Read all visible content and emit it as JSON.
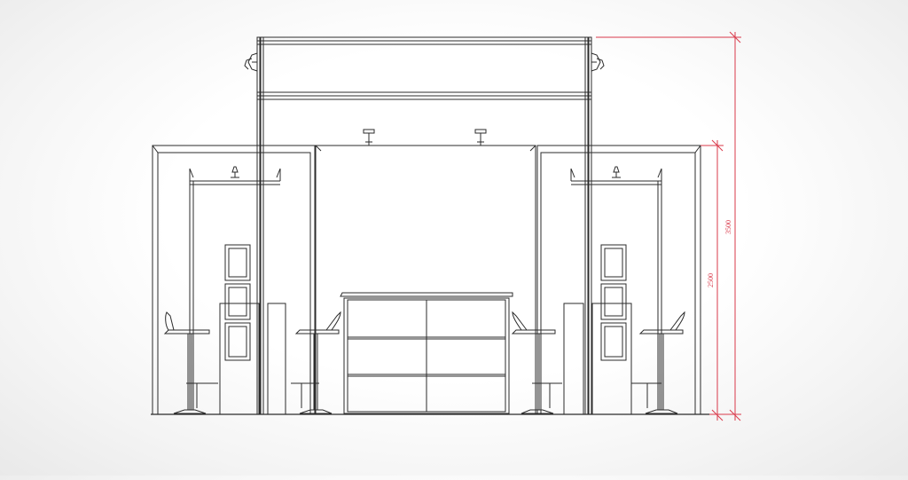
{
  "drawing": {
    "line_color": "#2b2b2b",
    "dimension_color": "#d9394a",
    "dimensions": [
      {
        "id": "overall-height",
        "label": "3500"
      },
      {
        "id": "wall-height",
        "label": "2500"
      }
    ]
  }
}
